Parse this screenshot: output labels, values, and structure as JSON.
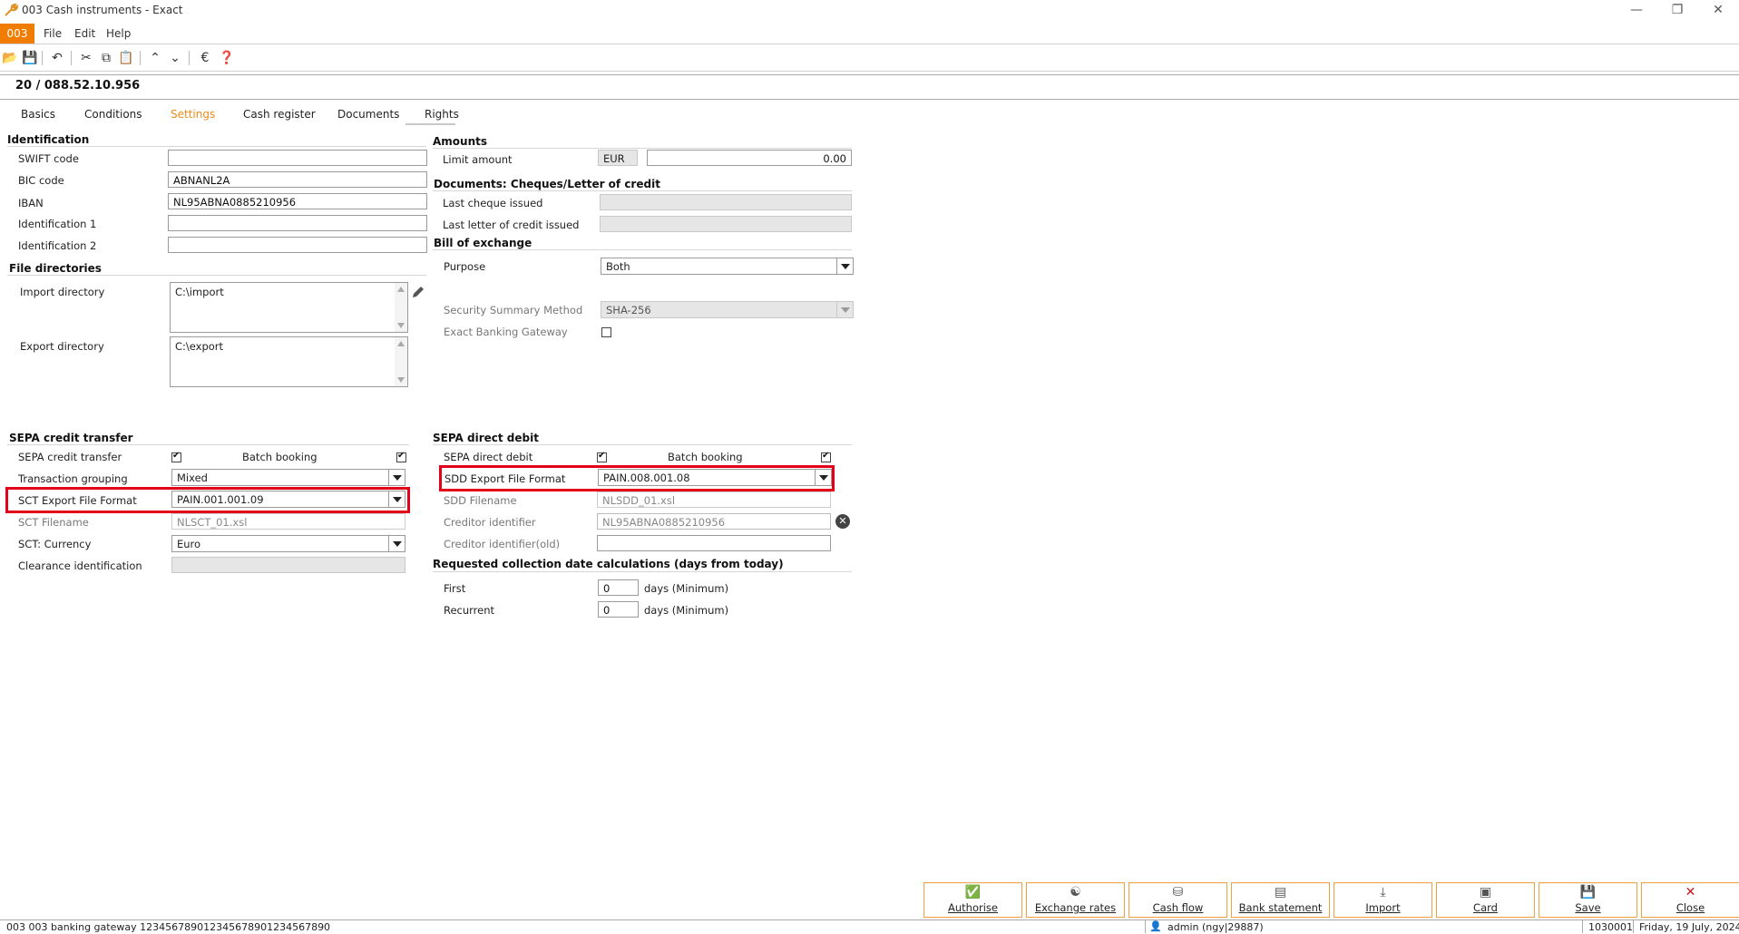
{
  "window": {
    "title": "003 Cash instruments - Exact"
  },
  "menu": {
    "company": "003",
    "items": [
      "File",
      "Edit",
      "Help"
    ]
  },
  "record": {
    "title": "20 / 088.52.10.956"
  },
  "tabs": [
    "Basics",
    "Conditions",
    "Settings",
    "Cash register",
    "Documents",
    "Rights"
  ],
  "identification": {
    "header": "Identification",
    "swift_label": "SWIFT code",
    "swift_value": "",
    "bic_label": "BIC code",
    "bic_value": "ABNANL2A",
    "iban_label": "IBAN",
    "iban_value": "NL95ABNA0885210956",
    "id1_label": "Identification 1",
    "id1_value": "",
    "id2_label": "Identification 2",
    "id2_value": ""
  },
  "file_directories": {
    "header": "File directories",
    "import_label": "Import directory",
    "import_value": "C:\\import",
    "export_label": "Export directory",
    "export_value": "C:\\export"
  },
  "amounts": {
    "header": "Amounts",
    "limit_label": "Limit amount",
    "currency": "EUR",
    "limit_value": "0.00"
  },
  "documents": {
    "header": "Documents: Cheques/Letter of credit",
    "cheque_label": "Last cheque issued",
    "letter_label": "Last letter of credit issued"
  },
  "bill": {
    "header": "Bill of exchange",
    "purpose_label": "Purpose",
    "purpose_value": "Both",
    "security_label": "Security Summary Method",
    "security_value": "SHA-256",
    "gateway_label": "Exact Banking Gateway"
  },
  "sct": {
    "header": "SEPA credit transfer",
    "transfer_label": "SEPA credit transfer",
    "batch_label": "Batch booking",
    "grouping_label": "Transaction grouping",
    "grouping_value": "Mixed",
    "format_label": "SCT Export File Format",
    "format_value": "PAIN.001.001.09",
    "filename_label": "SCT Filename",
    "filename_value": "NLSCT_01.xsl",
    "currency_label": "SCT: Currency",
    "currency_value": "Euro",
    "clearance_label": "Clearance identification"
  },
  "sdd": {
    "header": "SEPA direct debit",
    "debit_label": "SEPA direct debit",
    "batch_label": "Batch booking",
    "format_label": "SDD Export File Format",
    "format_value": "PAIN.008.001.08",
    "filename_label": "SDD Filename",
    "filename_value": "NLSDD_01.xsl",
    "creditor_label": "Creditor identifier",
    "creditor_value": "NL95ABNA0885210956",
    "creditor_old_label": "Creditor identifier(old)",
    "creditor_old_value": ""
  },
  "collection": {
    "header": "Requested collection date calculations (days from today)",
    "first_label": "First",
    "first_value": "0",
    "recurrent_label": "Recurrent",
    "recurrent_value": "0",
    "unit": "days (Minimum)"
  },
  "buttons": {
    "authorise": "Authorise",
    "exchange": "Exchange rates",
    "cashflow": "Cash flow",
    "bank": "Bank statement",
    "import": "Import",
    "card": "Card",
    "save": "Save",
    "close": "Close"
  },
  "status": {
    "left": "003 003 banking gateway 1234567890123456789012345678​90",
    "user": "admin (ngy|29887)",
    "code": "1030001",
    "date": "Friday, 19 July, 2024"
  },
  "colors": {
    "accent": "#f07d00",
    "highlight": "#e2001a"
  }
}
